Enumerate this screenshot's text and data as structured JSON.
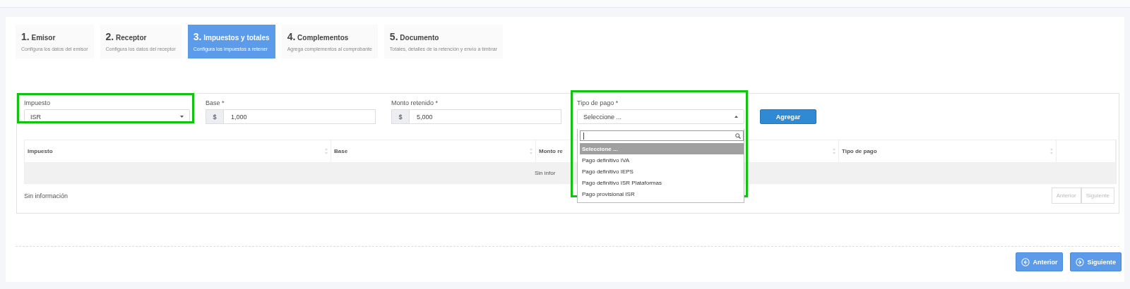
{
  "steps": [
    {
      "number": "1.",
      "title": "Emisor",
      "subtitle": "Configura los datos del emisor",
      "selected": false
    },
    {
      "number": "2.",
      "title": "Receptor",
      "subtitle": "Configura los datos del receptor",
      "selected": false
    },
    {
      "number": "3.",
      "title": "Impuestos y totales",
      "subtitle": "Configura los impuestos a retener",
      "selected": true
    },
    {
      "number": "4.",
      "title": "Complementos",
      "subtitle": "Agrega complementos al comprobante",
      "selected": false
    },
    {
      "number": "5.",
      "title": "Documento",
      "subtitle": "Totales, detalles de la retención y envío a timbrar",
      "selected": false
    }
  ],
  "form": {
    "impuesto": {
      "label": "Impuesto",
      "value": "ISR",
      "highlighted": true
    },
    "base": {
      "label": "Base *",
      "prefix": "$",
      "value": "1,000"
    },
    "monto": {
      "label": "Monto retenido *",
      "prefix": "$",
      "value": "5,000"
    },
    "tipo_pago": {
      "label": "Tipo de pago *",
      "value": "Seleccione ...",
      "highlighted": true,
      "expanded": true,
      "options": [
        {
          "label": "Seleccione ...",
          "selected": true
        },
        {
          "label": "Pago definitivo IVA",
          "selected": false
        },
        {
          "label": "Pago definitivo IEPS",
          "selected": false
        },
        {
          "label": "Pago definitivo ISR Plataformas",
          "selected": false
        },
        {
          "label": "Pago provisional ISR",
          "selected": false
        }
      ]
    },
    "add_button": "Agregar"
  },
  "table": {
    "columns": [
      "Impuesto",
      "Base",
      "Monto re",
      "Tipo de pago"
    ],
    "empty_row": "Sin infor",
    "footer": "Sin información",
    "pagination": [
      {
        "label": "Anterior",
        "disabled": true
      },
      {
        "label": "Siguiente",
        "disabled": true
      }
    ]
  },
  "nav_buttons": [
    {
      "label": "Anterior"
    },
    {
      "label": "Siguiente"
    }
  ]
}
